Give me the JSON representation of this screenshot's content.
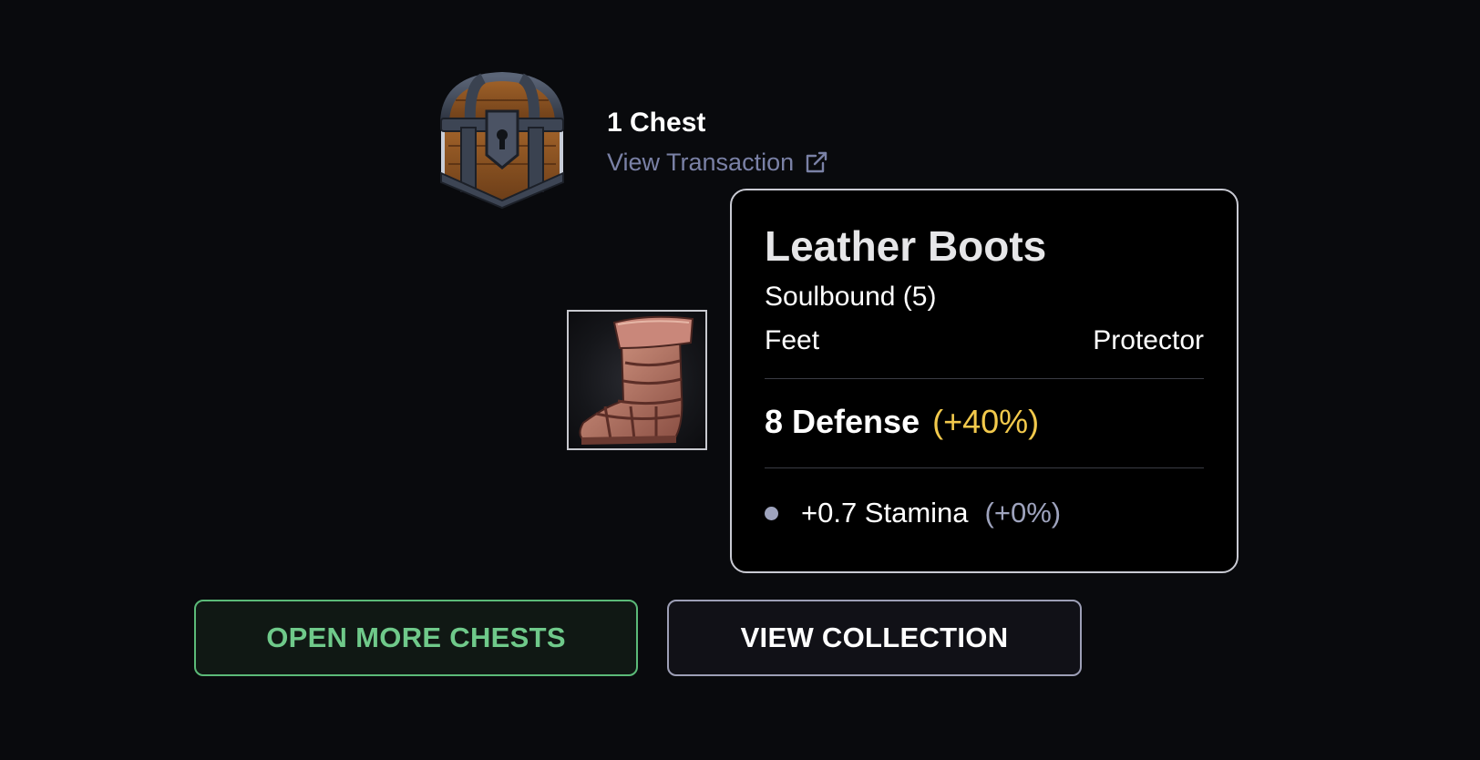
{
  "reward": {
    "chest_image": "treasure-chest",
    "title": "1 Chest",
    "transaction_link": "View Transaction",
    "link_icon": "external-link-icon"
  },
  "item": {
    "image": "leather-boot",
    "name": "Leather Boots",
    "binding": "Soulbound (5)",
    "slot": "Feet",
    "type": "Protector",
    "defense": "8 Defense",
    "defense_bonus": "(+40%)",
    "stats": [
      {
        "value": "+0.7 Stamina",
        "bonus": "(+0%)"
      }
    ]
  },
  "buttons": {
    "open_more": "OPEN MORE CHESTS",
    "view_collection": "VIEW COLLECTION"
  },
  "colors": {
    "background": "#090a0d",
    "link": "#7a81a6",
    "defense_bonus": "#f2c94c",
    "stat_bonus": "#9ea3bd",
    "open_button": "#5bba78",
    "view_button_border": "#9d9fb6"
  }
}
